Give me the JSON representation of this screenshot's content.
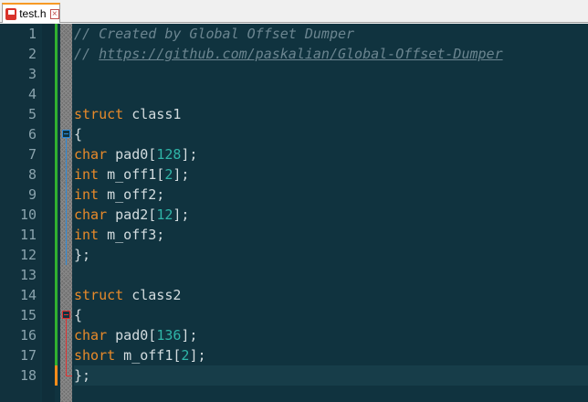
{
  "tab": {
    "label": "test.h",
    "file_icon": "file-icon",
    "close_icon": "close-icon",
    "close_glyph": "×"
  },
  "editor": {
    "line_numbers": [
      "1",
      "2",
      "3",
      "4",
      "5",
      "6",
      "7",
      "8",
      "9",
      "10",
      "11",
      "12",
      "13",
      "14",
      "15",
      "16",
      "17",
      "18"
    ],
    "current_line": 18,
    "lines": {
      "l1": {
        "comment": "// Created by Global Offset Dumper"
      },
      "l2": {
        "prefix": "// ",
        "url": "https://github.com/paskalian/Global-Offset-Dumper"
      },
      "l5": {
        "kw": "struct",
        "name": " class1"
      },
      "l6": {
        "text": "{"
      },
      "l7": {
        "kw": "char",
        "a": " pad0[",
        "n": "128",
        "b": "];"
      },
      "l8": {
        "kw": "int",
        "a": " m_off1[",
        "n": "2",
        "b": "];"
      },
      "l9": {
        "kw": "int",
        "a": " m_off2;"
      },
      "l10": {
        "kw": "char",
        "a": " pad2[",
        "n": "12",
        "b": "];"
      },
      "l11": {
        "kw": "int",
        "a": " m_off3;"
      },
      "l12": {
        "text": "};"
      },
      "l14": {
        "kw": "struct",
        "name": " class2"
      },
      "l15": {
        "text": "{"
      },
      "l16": {
        "kw": "char",
        "a": " pad0[",
        "n": "136",
        "b": "];"
      },
      "l17": {
        "kw": "short",
        "a": " m_off1[",
        "n": "2",
        "b": "];"
      },
      "l18": {
        "text": "};"
      }
    }
  },
  "colors": {
    "background": "#10333f",
    "keyword": "#e88a2a",
    "number": "#2fb5a8",
    "comment": "#6b8590",
    "text": "#d3dcdf"
  }
}
